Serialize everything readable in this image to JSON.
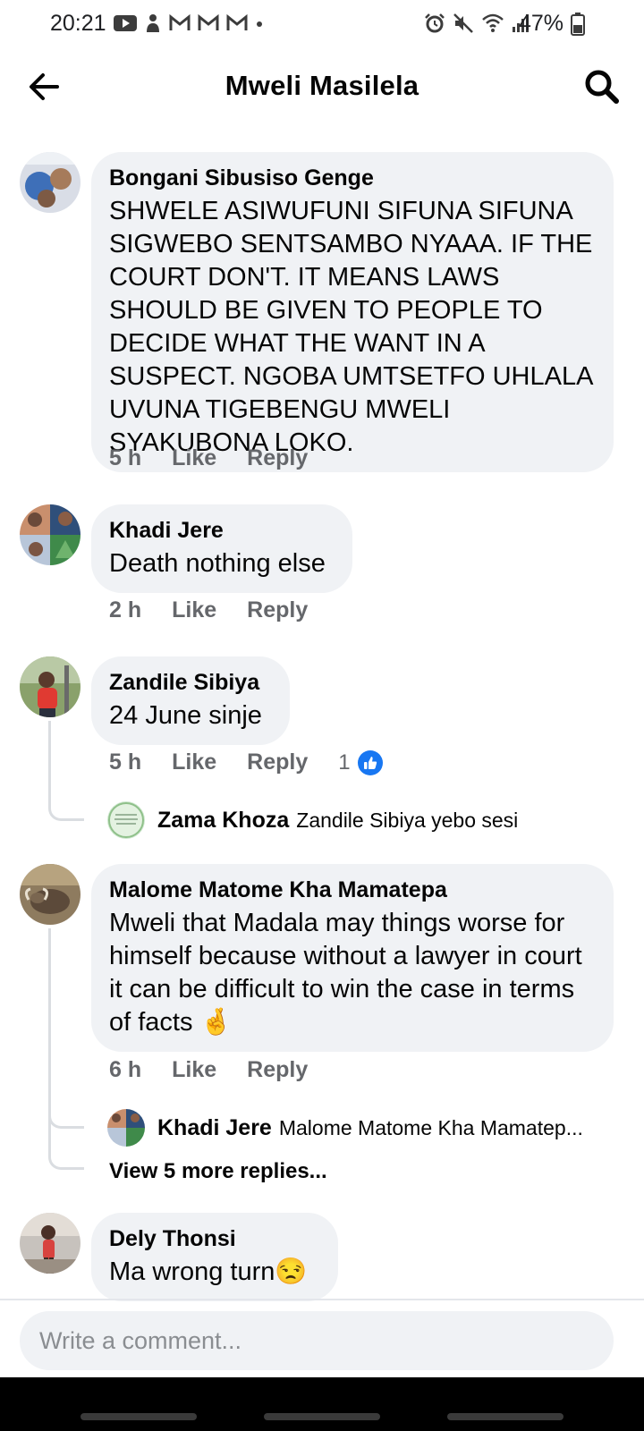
{
  "status_bar": {
    "time": "20:21",
    "battery": "47%",
    "left_icons": [
      "youtube-icon",
      "notification-icon",
      "gmail-icon",
      "gmail-icon",
      "gmail-icon",
      "dot-icon"
    ],
    "right_icons": [
      "alarm-icon",
      "mute-icon",
      "wifi-icon",
      "signal-icon",
      "battery-icon"
    ]
  },
  "header": {
    "title": "Mweli Masilela",
    "back_icon": "back-arrow-icon",
    "search_icon": "search-icon"
  },
  "comments": [
    {
      "author": "Bongani Sibusiso Genge",
      "text": "SHWELE ASIWUFUNI SIFUNA SIFUNA SIGWEBO SENTSAMBO NYAAA. IF  THE COURT DON'T. IT MEANS LAWS SHOULD BE GIVEN TO PEOPLE TO DECIDE WHAT THE WANT IN A SUSPECT. NGOBA UMTSETFO UHLALA UVUNA TIGEBENGU MWELI SYAKUBONA LOKO.",
      "time": "5 h",
      "like": "Like",
      "reply": "Reply"
    },
    {
      "author": "Khadi Jere",
      "text": "Death nothing else",
      "time": "2 h",
      "like": "Like",
      "reply": "Reply"
    },
    {
      "author": "Zandile Sibiya",
      "text": "24 June sinje",
      "time": "5 h",
      "like": "Like",
      "reply": "Reply",
      "reaction_count": "1",
      "reply_preview": {
        "author": "Zama Khoza",
        "text": "Zandile Sibiya yebo sesi"
      }
    },
    {
      "author": "Malome Matome Kha Mamatepa",
      "text": "Mweli that Madala may things worse for himself because without a lawyer in court it can be difficult to win the case in terms of facts 🤞",
      "time": "6 h",
      "like": "Like",
      "reply": "Reply",
      "reply_preview": {
        "author": "Khadi Jere",
        "text": "Malome Matome Kha Mamatep..."
      },
      "view_more": "View 5 more replies..."
    },
    {
      "author": "Dely Thonsi",
      "text": "Ma wrong turn😒"
    }
  ],
  "composer": {
    "placeholder": "Write a comment..."
  },
  "colors": {
    "bubble": "#f0f2f5",
    "meta": "#65676b",
    "like_blue": "#1877f2",
    "thread_line": "#dadde1"
  }
}
